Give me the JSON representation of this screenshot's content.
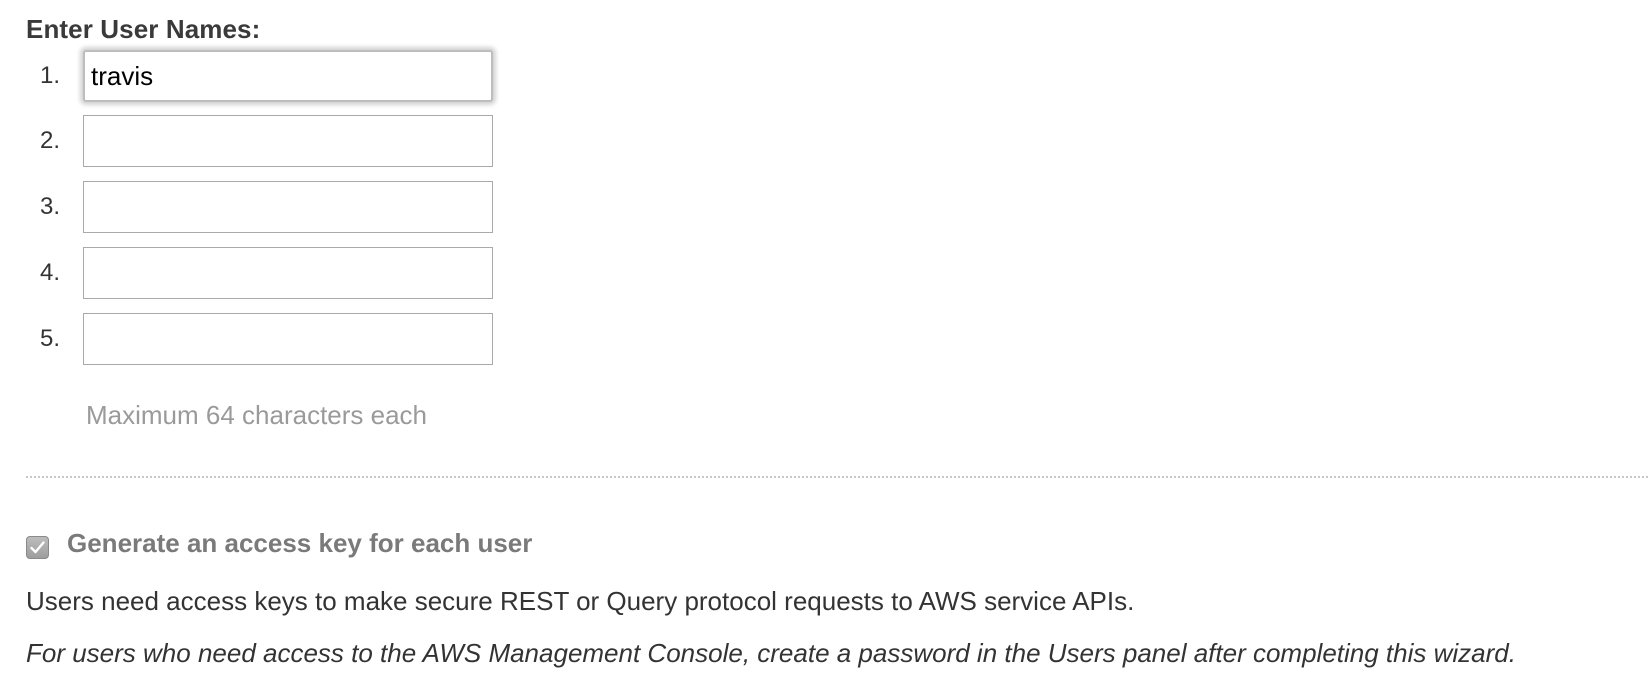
{
  "form": {
    "heading": "Enter User Names:",
    "users": [
      {
        "number": "1.",
        "value": "travis"
      },
      {
        "number": "2.",
        "value": ""
      },
      {
        "number": "3.",
        "value": ""
      },
      {
        "number": "4.",
        "value": ""
      },
      {
        "number": "5.",
        "value": ""
      }
    ],
    "hint": "Maximum 64 characters each"
  },
  "access_key": {
    "checked": true,
    "label": "Generate an access key for each user",
    "description": "Users need access keys to make secure REST or Query protocol requests to AWS service APIs.",
    "note": "For users who need access to the AWS Management Console, create a password in the Users panel after completing this wizard."
  }
}
